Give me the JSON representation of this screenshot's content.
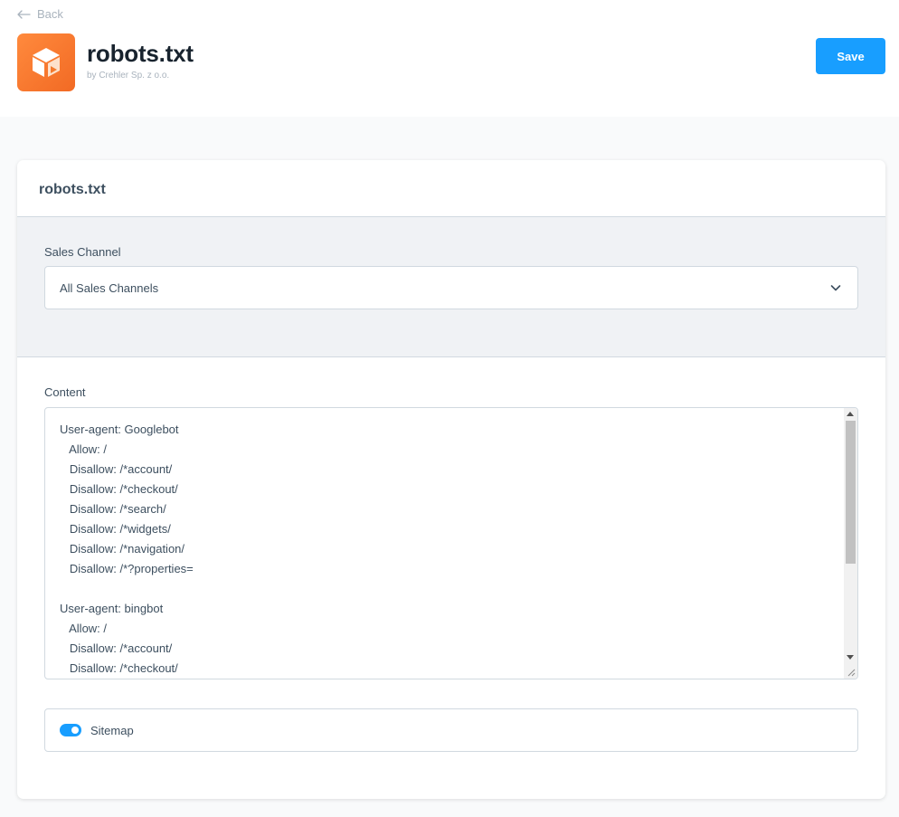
{
  "header": {
    "back_label": "Back",
    "app_title": "robots.txt",
    "app_subtitle": "by Crehler Sp. z o.o.",
    "save_label": "Save",
    "icon_color": "#f47a2e"
  },
  "card": {
    "title": "robots.txt",
    "sales_channel": {
      "label": "Sales Channel",
      "selected": "All Sales Channels"
    },
    "content": {
      "label": "Content",
      "lines": [
        "User-agent: Googlebot",
        "   Allow: /",
        "   Disallow: /*account/",
        "   Disallow: /*checkout/",
        "   Disallow: /*search/",
        "   Disallow: /*widgets/",
        "   Disallow: /*navigation/",
        "   Disallow: /*?properties=",
        "",
        "User-agent: bingbot",
        "   Allow: /",
        "   Disallow: /*account/",
        "   Disallow: /*checkout/"
      ]
    },
    "sitemap": {
      "label": "Sitemap",
      "enabled": true
    }
  },
  "colors": {
    "accent": "#189eff",
    "text": "#3d4f5f",
    "muted": "#a9b3bd"
  }
}
